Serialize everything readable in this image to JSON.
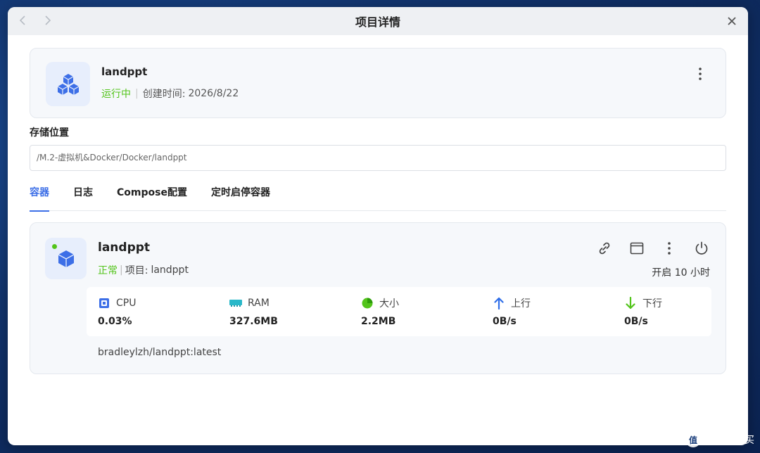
{
  "window": {
    "title": "项目详情"
  },
  "project": {
    "name": "landppt",
    "status": "运行中",
    "created_label": "创建时间:",
    "created_value": "2026/8/22"
  },
  "storage": {
    "label": "存储位置",
    "path": "/M.2-虚拟机&Docker/Docker/landppt"
  },
  "tabs": [
    {
      "label": "容器",
      "active": true
    },
    {
      "label": "日志",
      "active": false
    },
    {
      "label": "Compose配置",
      "active": false
    },
    {
      "label": "定时启停容器",
      "active": false
    }
  ],
  "container": {
    "name": "landppt",
    "status": "正常",
    "project_label": "项目:",
    "project_value": "landppt",
    "uptime": "开启 10 小时",
    "image": "bradleylzh/landppt:latest",
    "stats": [
      {
        "label": "CPU",
        "value": "0.03%",
        "icon": "cpu-icon"
      },
      {
        "label": "RAM",
        "value": "327.6MB",
        "icon": "ram-icon"
      },
      {
        "label": "大小",
        "value": "2.2MB",
        "icon": "pie-icon"
      },
      {
        "label": "上行",
        "value": "0B/s",
        "icon": "arrow-up-icon"
      },
      {
        "label": "下行",
        "value": "0B/s",
        "icon": "arrow-down-icon"
      }
    ]
  },
  "watermark": {
    "badge": "值",
    "text": "什么值得买"
  },
  "colors": {
    "accent": "#3d6fe7",
    "running": "#52c41a",
    "upload": "#2f6ee8",
    "download": "#52c41a"
  }
}
